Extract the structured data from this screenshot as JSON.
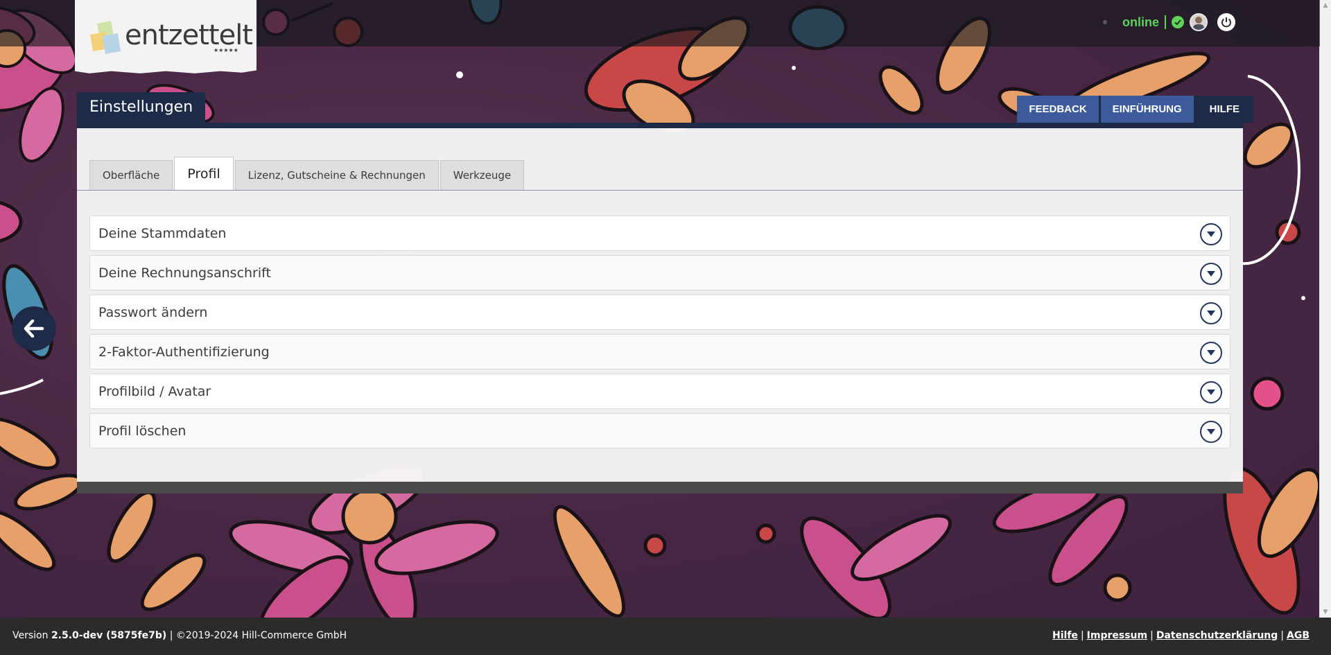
{
  "brand": {
    "logo_text": "entzettelt",
    "logo_stars": "★★★★★"
  },
  "topbar": {
    "status_text": "online",
    "status_color": "#5fd25a",
    "icons": [
      "check-circle-icon",
      "avatar",
      "power-icon"
    ]
  },
  "panel": {
    "title": "Einstellungen",
    "buttons": {
      "feedback": "FEEDBACK",
      "intro": "EINFÜHRUNG",
      "help": "HILFE"
    }
  },
  "tabs": [
    {
      "label": "Oberfläche",
      "active": false
    },
    {
      "label": "Profil",
      "active": true
    },
    {
      "label": "Lizenz, Gutscheine & Rechnungen",
      "active": false
    },
    {
      "label": "Werkzeuge",
      "active": false
    }
  ],
  "accordion": [
    {
      "label": "Deine Stammdaten"
    },
    {
      "label": "Deine Rechnungsanschrift"
    },
    {
      "label": "Passwort ändern"
    },
    {
      "label": "2-Faktor-Authentifizierung"
    },
    {
      "label": "Profilbild / Avatar"
    },
    {
      "label": "Profil löschen"
    }
  ],
  "footer": {
    "version_prefix": "Version ",
    "version": "2.5.0-dev (5875fe7b)",
    "copyright": " | ©2019-2024 Hill-Commerce GmbH",
    "links": {
      "hilfe": "Hilfe",
      "impressum": "Impressum",
      "datenschutz": "Datenschutzerklärung",
      "agb": "AGB"
    },
    "separator": "|"
  },
  "colors": {
    "navy": "#1e2b48",
    "button_blue": "#3d5b9a",
    "background_purple": "#4a2a44"
  }
}
